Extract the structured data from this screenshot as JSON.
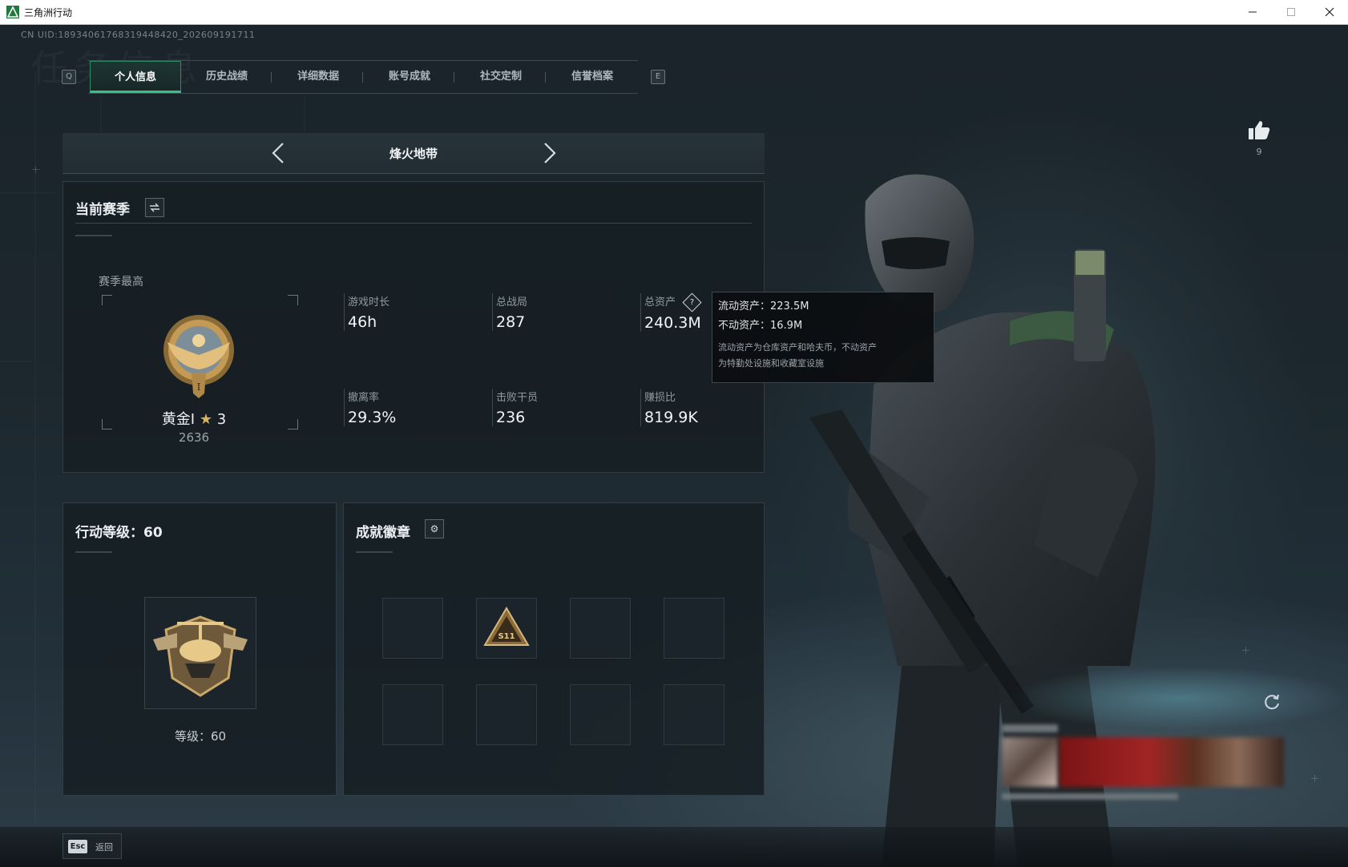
{
  "window": {
    "title": "三角洲行动",
    "colors": {
      "accent": "#33c47f",
      "panel": "#161e23",
      "text": "#e9eef1"
    }
  },
  "header": {
    "uid": "CN UID:18934061768319448420_202609191711",
    "watermark": "任务信息",
    "tabs": [
      {
        "label": "个人信息",
        "active": true
      },
      {
        "label": "历史战绩"
      },
      {
        "label": "详细数据"
      },
      {
        "label": "账号成就"
      },
      {
        "label": "社交定制"
      },
      {
        "label": "信誉档案"
      }
    ],
    "key_prev": "Q",
    "key_next": "E"
  },
  "mode": {
    "name": "烽火地带"
  },
  "season": {
    "title": "当前赛季",
    "best_label": "赛季最高",
    "rank_name": "黄金I",
    "rank_stars": "3",
    "rank_points": "2636",
    "stats": [
      {
        "label": "游戏时长",
        "value": "46h"
      },
      {
        "label": "总战局",
        "value": "287"
      },
      {
        "label": "总资产",
        "value": "240.3M"
      },
      {
        "label": "撤离率",
        "value": "29.3%"
      },
      {
        "label": "击败干员",
        "value": "236"
      },
      {
        "label": "赚损比",
        "value": "819.9K"
      }
    ]
  },
  "tooltip": {
    "liquid": "流动资产：223.5M",
    "fixed": "不动资产：16.9M",
    "note_line1": "流动资产为仓库资产和哈夫币，不动资产",
    "note_line2": "为特勤处设施和收藏室设施"
  },
  "level": {
    "title": "行动等级：60",
    "label": "等级：60"
  },
  "badges": {
    "title": "成就徽章",
    "badge_text": "S11"
  },
  "likes": {
    "count": "9"
  },
  "footer": {
    "esc_key": "Esc",
    "esc_label": "返回"
  }
}
